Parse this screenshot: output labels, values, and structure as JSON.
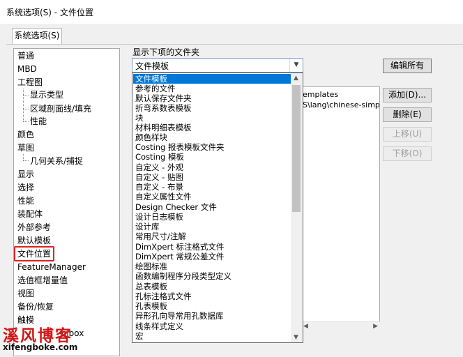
{
  "window": {
    "title": "系统选项(S) - 文件位置"
  },
  "tabs": [
    {
      "label": "系统选项(S)"
    }
  ],
  "nav": {
    "items": [
      {
        "label": "普通"
      },
      {
        "label": "MBD"
      },
      {
        "label": "工程图"
      },
      {
        "label": "显示类型"
      },
      {
        "label": "区域剖面线/填充"
      },
      {
        "label": "性能"
      },
      {
        "label": "颜色"
      },
      {
        "label": "草图"
      },
      {
        "label": "几何关系/捕捉"
      },
      {
        "label": "显示"
      },
      {
        "label": "选择"
      },
      {
        "label": "性能"
      },
      {
        "label": "装配体"
      },
      {
        "label": "外部参考"
      },
      {
        "label": "默认模板"
      },
      {
        "label": "文件位置"
      },
      {
        "label": "FeatureManager"
      },
      {
        "label": "选值框增量值"
      },
      {
        "label": "视图"
      },
      {
        "label": "备份/恢复"
      },
      {
        "label": "触模"
      },
      {
        "label": "olbox"
      }
    ],
    "selected": "文件位置"
  },
  "folders": {
    "label": "显示下项的文件夹",
    "selected": "文件模板",
    "options": [
      "文件模板",
      "参考的文件",
      "默认保存文件夹",
      "折弯系数表模板",
      "块",
      "材料明细表模板",
      "颜色样块",
      "Costing 报表模板文件夹",
      "Costing 模板",
      "自定义 - 外观",
      "自定义 - 贴图",
      "自定义 - 布景",
      "自定义属性文件",
      "Design Checker 文件",
      "设计日志模板",
      "设计库",
      "常用尺寸/注解",
      "DimXpert 标注格式文件",
      "DimXpert 常规公差文件",
      "绘图标准",
      "函数编制程序分段类型定义",
      "总表模板",
      "孔标注格式文件",
      "孔表模板",
      "异形孔向导常用孔数据库",
      "线条样式定义",
      "宏"
    ]
  },
  "paths": {
    "lines": [
      "emplates",
      "S\\lang\\chinese-simplifi"
    ]
  },
  "buttons": {
    "edit_all": "编辑所有",
    "add": "添加(D)...",
    "delete": "删除(E)",
    "move_up": "上移(U)",
    "move_down": "下移(O)"
  },
  "watermark": {
    "text": "溪风博客",
    "url": "xifengboke.com"
  }
}
